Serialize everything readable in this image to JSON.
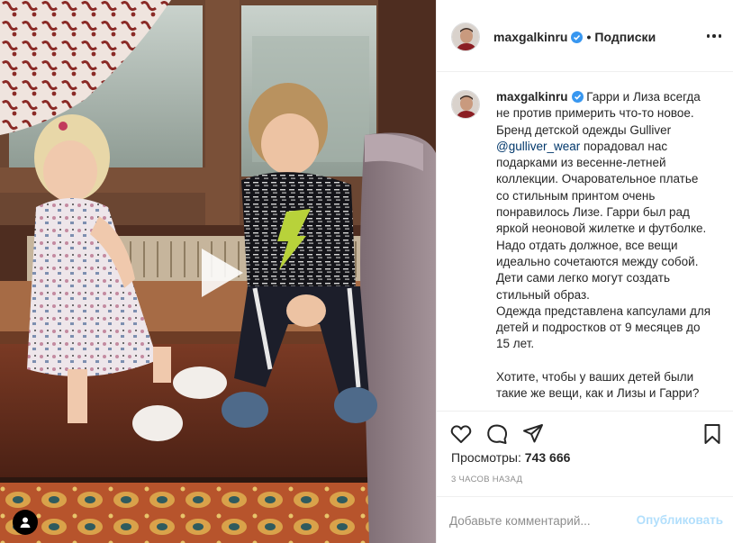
{
  "post": {
    "username": "maxgalkinru",
    "separator": "•",
    "follow_label": "Подписки",
    "verified_icon": "verified-badge-icon",
    "more_icon": "more-options-icon"
  },
  "caption": {
    "username": "maxgalkinru",
    "text_1": "Гарри и Лиза всегда не против примерить что-то новое. Бренд детской одежды Gulliver ",
    "mention": "@gulliver_wear",
    "text_2": " порадовал нас подарками из весенне-летней коллекции. Очаровательное платье со стильным принтом очень понравилось Лизе. Гарри был рад яркой неоновой жилетке и футболке.",
    "para_2": "Надо отдать должное, все вещи идеально сочетаются между собой. Дети сами легко могут создать стильный образ.",
    "para_3": "Одежда представлена капсулами для детей и подростков от 9 месяцев до 15 лет.",
    "para_4": "Хотите, чтобы у ваших детей были такие же вещи, как и Лизы и Гарри?"
  },
  "stats": {
    "views_label": "Просмотры:",
    "views_count": "743 666",
    "time_ago": "3 часов назад"
  },
  "comment": {
    "placeholder": "Добавьте комментарий...",
    "publish_label": "Опубликовать"
  },
  "colors": {
    "accent": "#0095f6",
    "publish_disabled": "#b2dffc",
    "mention": "#00376b",
    "muted": "#8e8e8e",
    "border": "#efefef"
  },
  "icons": {
    "play": "play-icon",
    "tagged_user": "user-tag-icon",
    "like": "heart-icon",
    "comment": "comment-icon",
    "share": "send-icon",
    "save": "bookmark-icon"
  }
}
